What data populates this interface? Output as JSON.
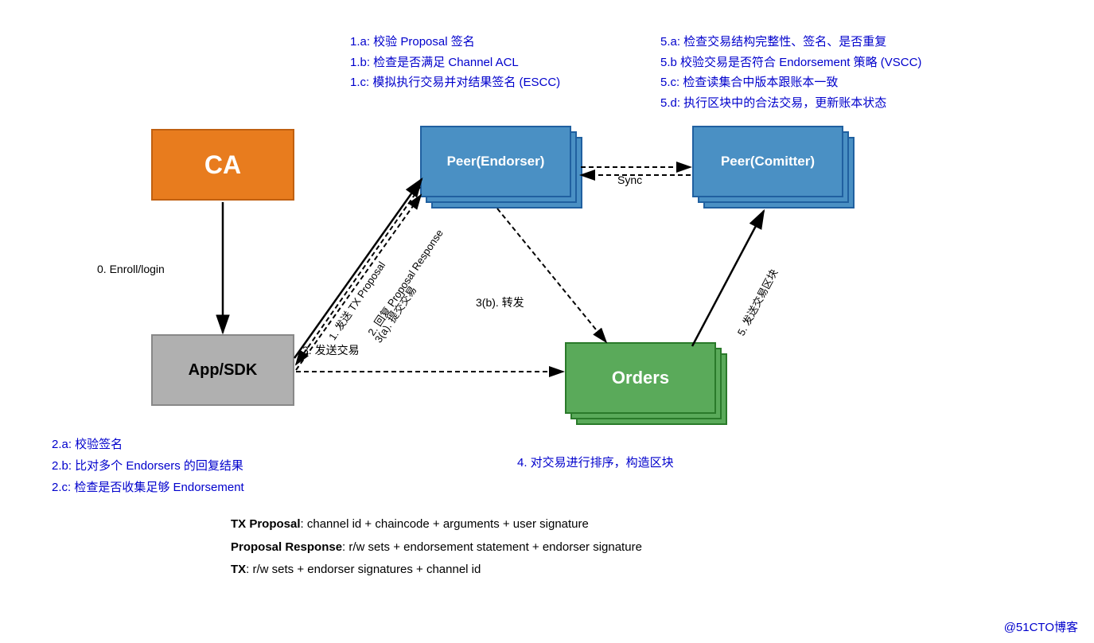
{
  "top_left_notes": {
    "line1": "1.a: 校验 Proposal 签名",
    "line2": "1.b: 检查是否满足 Channel ACL",
    "line3": "1.c: 模拟执行交易并对结果签名 (ESCC)"
  },
  "top_right_notes": {
    "line1": "5.a: 检查交易结构完整性、签名、是否重复",
    "line2": "5.b 校验交易是否符合 Endorsement 策略 (VSCC)",
    "line3": "5.c: 检查读集合中版本跟账本一致",
    "line4": "5.d: 执行区块中的合法交易，更新账本状态"
  },
  "ca_box": {
    "label": "CA"
  },
  "app_box": {
    "label": "App/SDK"
  },
  "peer_endorser_box": {
    "label": "Peer(Endorser)"
  },
  "peer_comitter_box": {
    "label": "Peer(Comitter)"
  },
  "orders_box": {
    "label": "Orders"
  },
  "enroll_label": "0. Enroll/login",
  "send_tx_label": "3. 发送交易",
  "forward_label": "3(b). 转发",
  "sync_label": "Sync",
  "arrow_labels": {
    "proposal": "1. 发送 TX Proposal",
    "response": "2. 回复 Proposal Response",
    "submit": "3(a). 提交交易",
    "send_block": "5. 发送交易区块"
  },
  "bottom_left_notes": {
    "line1": "2.a: 校验签名",
    "line2": "2.b: 比对多个 Endorsers 的回复结果",
    "line3": "2.c: 检查是否收集足够 Endorsement"
  },
  "bottom_center_note": "4. 对交易进行排序，构造区块",
  "definitions": {
    "line1_bold": "TX Proposal",
    "line1_rest": ": channel id + chaincode + arguments + user signature",
    "line2_bold": "Proposal Response",
    "line2_rest": ": r/w sets + endorsement statement + endorser signature",
    "line3_bold": "TX",
    "line3_rest": ": r/w sets + endorser signatures + channel id"
  },
  "watermark": "@51CTO博客"
}
